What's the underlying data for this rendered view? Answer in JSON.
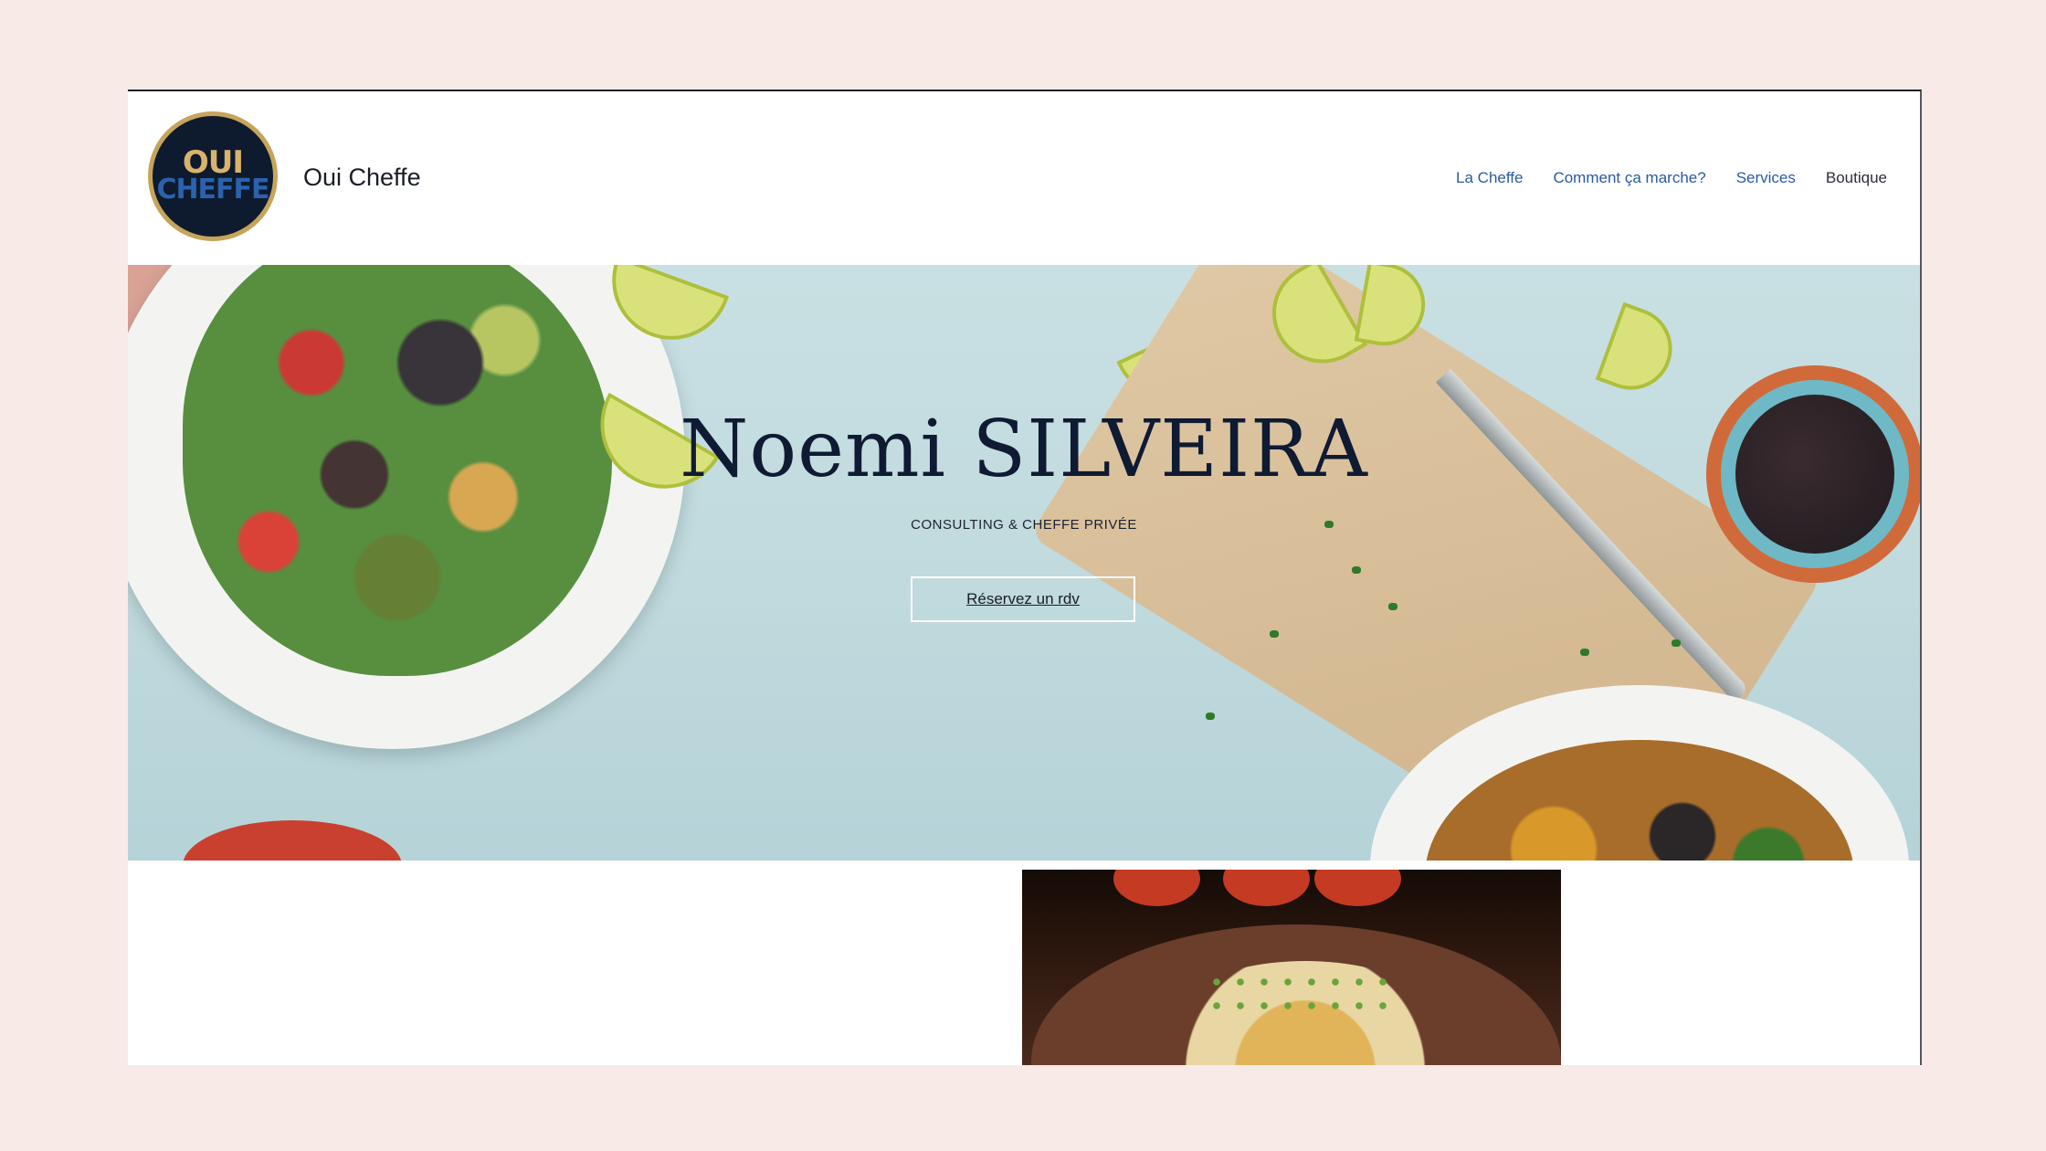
{
  "header": {
    "logo": {
      "line1": "OUI",
      "line2": "CHEFFE",
      "colors": {
        "ring": "#c6a45a",
        "bg": "#0e1a2e",
        "oui": "#d8b36a",
        "cheffe": "#2a62ad"
      }
    },
    "site_title": "Oui Cheffe",
    "nav": [
      {
        "label": "La Cheffe"
      },
      {
        "label": "Comment ça marche?"
      },
      {
        "label": "Services"
      },
      {
        "label": "Boutique"
      }
    ]
  },
  "hero": {
    "title": "Noemi SILVEIRA",
    "subtitle": "CONSULTING & CHEFFE PRIVÉE",
    "cta_label": "Réservez un rdv"
  },
  "colors": {
    "page_bg": "#f8ebe7",
    "link": "#2a5aa0",
    "title": "#0f1a33"
  }
}
